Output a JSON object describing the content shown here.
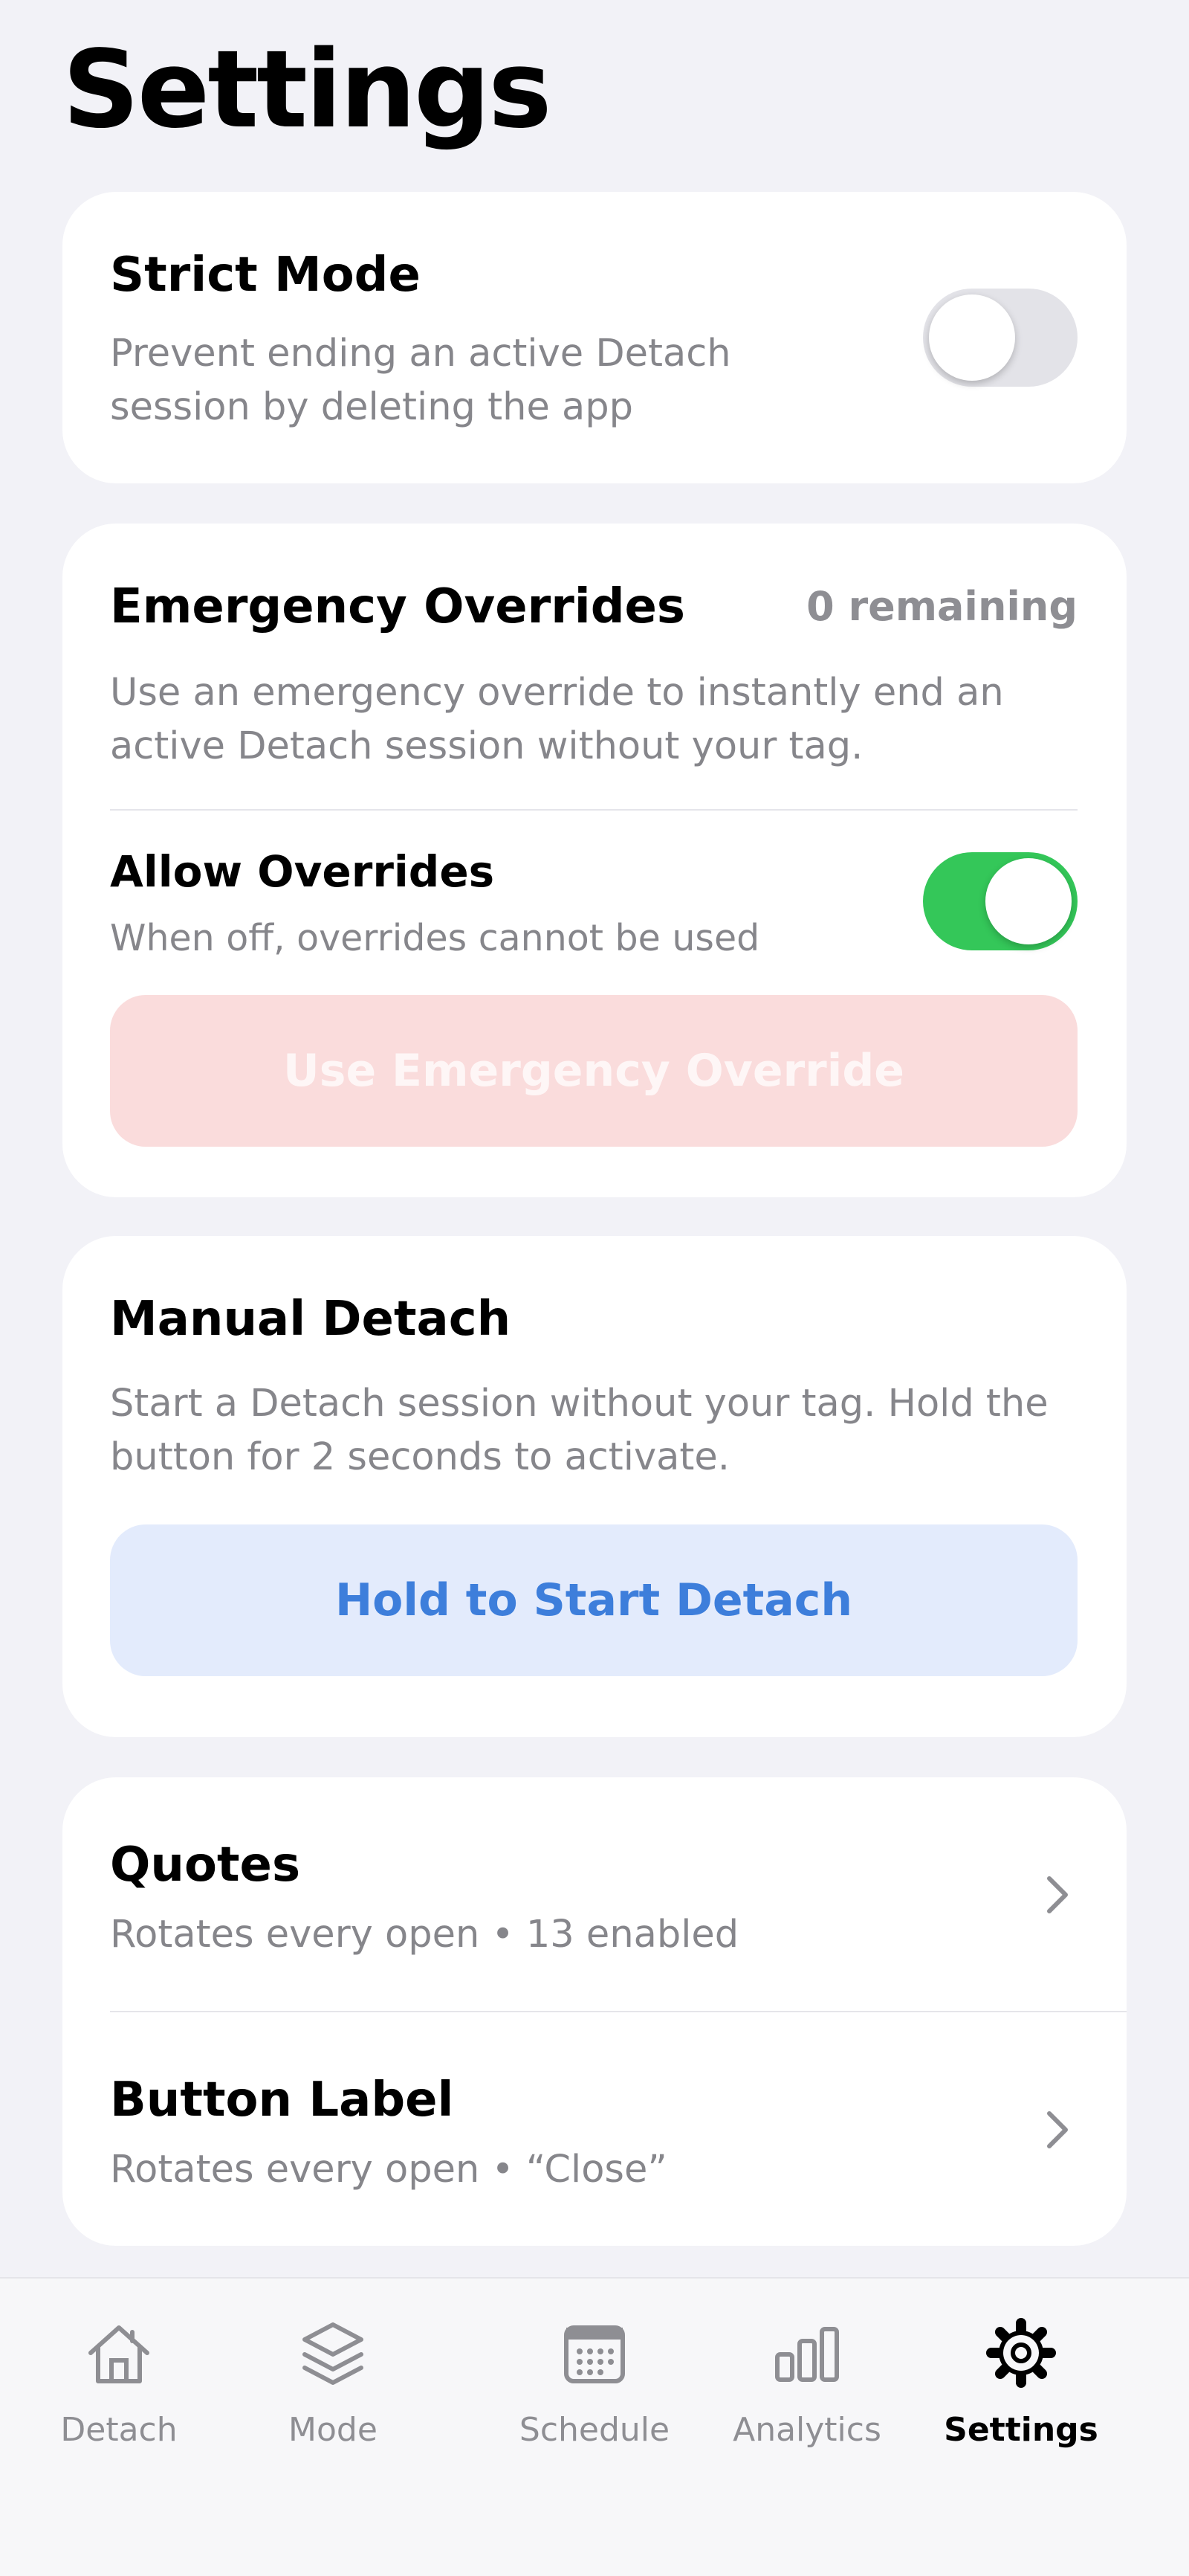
{
  "page": {
    "title": "Settings"
  },
  "strict_mode": {
    "title": "Strict Mode",
    "description_line1": "Prevent ending an active Detach",
    "description_line2": "session by deleting the app",
    "enabled": false
  },
  "emergency": {
    "title": "Emergency Overrides",
    "remaining": "0 remaining",
    "description_line1": "Use an emergency override to instantly end an",
    "description_line2": "active Detach session without your tag.",
    "allow": {
      "title": "Allow Overrides",
      "subtitle": "When off, overrides cannot be used",
      "enabled": true
    },
    "button_label": "Use Emergency Override"
  },
  "manual": {
    "title": "Manual Detach",
    "description_line1": "Start a Detach session without your tag. Hold the",
    "description_line2": "button for 2 seconds to activate.",
    "button_label": "Hold to Start Detach"
  },
  "nav": {
    "items": [
      {
        "title": "Quotes",
        "subtitle": "Rotates every open • 13 enabled"
      },
      {
        "title": "Button Label",
        "subtitle": "Rotates every open • “Close”"
      }
    ]
  },
  "tabbar": {
    "tabs": [
      {
        "label": "Detach",
        "icon": "house-icon"
      },
      {
        "label": "Mode",
        "icon": "layers-icon"
      },
      {
        "label": "Schedule",
        "icon": "calendar-icon"
      },
      {
        "label": "Analytics",
        "icon": "bar-chart-icon"
      },
      {
        "label": "Settings",
        "icon": "gear-icon"
      }
    ],
    "active": "Settings"
  },
  "colors": {
    "background": "#F2F2F7",
    "toggle_on": "#34C759",
    "toggle_off": "#E3E3E8",
    "override_button": "#FADCDC",
    "detach_button_bg": "#E3EBFC",
    "detach_button_text": "#3D7EDB"
  }
}
